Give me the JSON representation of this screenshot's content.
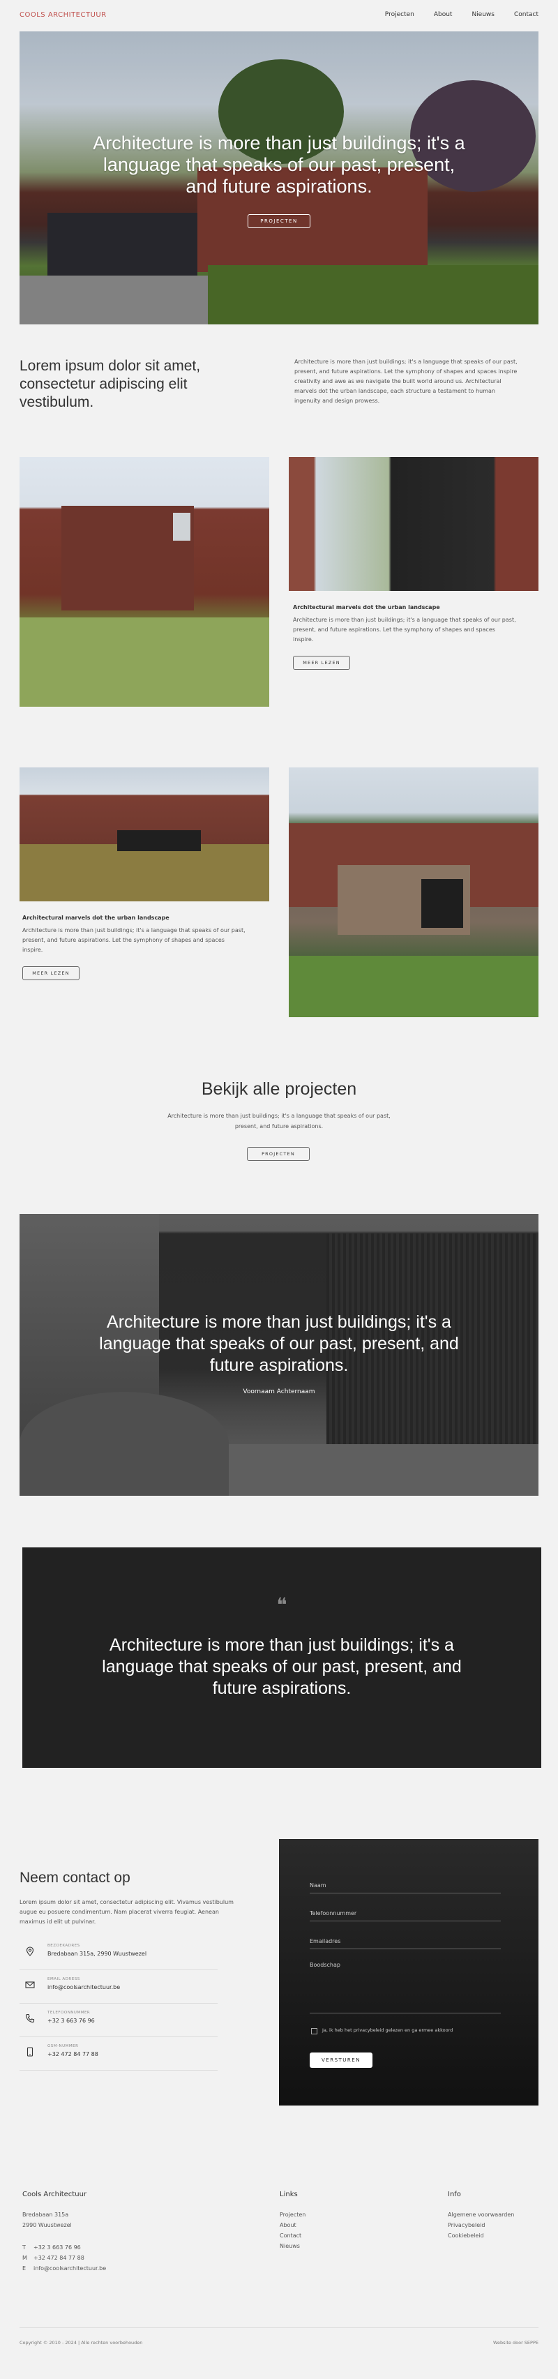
{
  "header": {
    "logo": "COOLS ARCHITECTUUR",
    "nav": [
      "Projecten",
      "About",
      "Nieuws",
      "Contact"
    ]
  },
  "hero": {
    "title": "Architecture is more than just buildings; it's a language that speaks of our past, present, and future aspirations.",
    "button": "PROJECTEN"
  },
  "intro": {
    "heading": "Lorem ipsum dolor sit amet, consectetur adipiscing elit vestibulum.",
    "text": "Architecture is more than just buildings; it's a language that speaks of our past, present, and future aspirations. Let the symphony of shapes and spaces inspire creativity and awe as we navigate the built world around us. Architectural marvels dot the urban landscape, each structure a testament to human ingenuity and design prowess."
  },
  "projects": [
    {
      "title": "Architectural marvels dot the urban landscape",
      "text": "Architecture is more than just buildings; it's a language that speaks of our past, present, and future aspirations. Let the symphony of shapes and spaces inspire.",
      "button": "MEER LEZEN"
    },
    {
      "title": "Architectural marvels dot the urban landscape",
      "text": "Architecture is more than just buildings; it's a language that speaks of our past, present, and future aspirations. Let the symphony of shapes and spaces inspire.",
      "button": "MEER LEZEN"
    }
  ],
  "all_projects": {
    "heading": "Bekijk alle projecten",
    "text": "Architecture is more than just buildings; it's a language that speaks of our past, present, and future aspirations.",
    "button": "PROJECTEN"
  },
  "quote_image": {
    "quote": "Architecture is more than just buildings; it's a language that speaks of our past, present, and future aspirations.",
    "author": "Voornaam Achternaam"
  },
  "quote_box": {
    "mark": "❝",
    "quote": "Architecture is more than just buildings; it's a language that speaks of our past, present, and future aspirations."
  },
  "contact": {
    "heading": "Neem contact op",
    "text": "Lorem ipsum dolor sit amet, consectetur adipiscing elit. Vivamus vestibulum augue eu posuere condimentum. Nam placerat viverra feugiat. Aenean maximus id elit ut pulvinar.",
    "rows": [
      {
        "label": "BEZOEKADRES",
        "value": "Bredabaan 315a, 2990 Wuustwezel",
        "icon": "location-icon"
      },
      {
        "label": "EMAIL ADRESS",
        "value": "info@coolsarchitectuur.be",
        "icon": "mail-icon"
      },
      {
        "label": "TELEFOONNUMMER",
        "value": "+32 3 663 76 96",
        "icon": "phone-icon"
      },
      {
        "label": "GSM-NUMMER",
        "value": "+32 472 84 77 88",
        "icon": "mobile-icon"
      }
    ],
    "form": {
      "name_placeholder": "Naam",
      "phone_placeholder": "Telefoonnummer",
      "email_placeholder": "Emailadres",
      "message_placeholder": "Boodschap",
      "checkbox_label": "Ja, ik heb het privacybeleid gelezen en ga ermee akkoord",
      "submit": "VERSTUREN"
    }
  },
  "footer": {
    "company": "Cools Architectuur",
    "address_line1": "Bredabaan 315a",
    "address_line2": "2990 Wuustwezel",
    "contacts": [
      {
        "prefix": "T",
        "value": "+32 3 663 76 96"
      },
      {
        "prefix": "M",
        "value": "+32 472 84 77 88"
      },
      {
        "prefix": "E",
        "value": "info@coolsarchitectuur.be"
      }
    ],
    "links_heading": "Links",
    "links": [
      "Projecten",
      "About",
      "Contact",
      "Nieuws"
    ],
    "info_heading": "Info",
    "info": [
      "Algemene voorwaarden",
      "Privacybeleid",
      "Cookiebeleid"
    ],
    "copyright": "Copyright © 2010 - 2024 | Alle rechten voorbehouden",
    "credit": "Website door SEPPE"
  },
  "colors": {
    "brand": "#c0504d",
    "background": "#f2f2f2",
    "dark": "#222222"
  }
}
